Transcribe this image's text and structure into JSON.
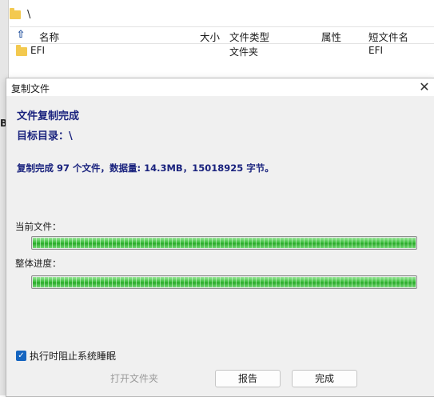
{
  "explorer": {
    "path": "\\",
    "columns": {
      "name": "名称",
      "size": "大小",
      "type": "文件类型",
      "attr": "属性",
      "short": "短文件名"
    },
    "rows": [
      {
        "name": "EFI",
        "type": "文件夹",
        "short": "EFI"
      }
    ],
    "side_letter": "B"
  },
  "dialog": {
    "title": "复制文件",
    "heading": "文件复制完成",
    "target": "目标目录：\\",
    "summary": "复制完成 97 个文件，数据量: 14.3MB，15018925 字节。",
    "current_label": "当前文件：",
    "total_label": "整体进度：",
    "current_progress": 1.0,
    "total_progress": 1.0,
    "prevent_sleep_label": "执行时阻止系统睡眠",
    "prevent_sleep_checked": true,
    "buttons": {
      "open_folder": "打开文件夹",
      "report": "报告",
      "done": "完成"
    }
  },
  "colors": {
    "accent": "#1565c0",
    "heading": "#1a237e",
    "progress": "#28a828"
  }
}
